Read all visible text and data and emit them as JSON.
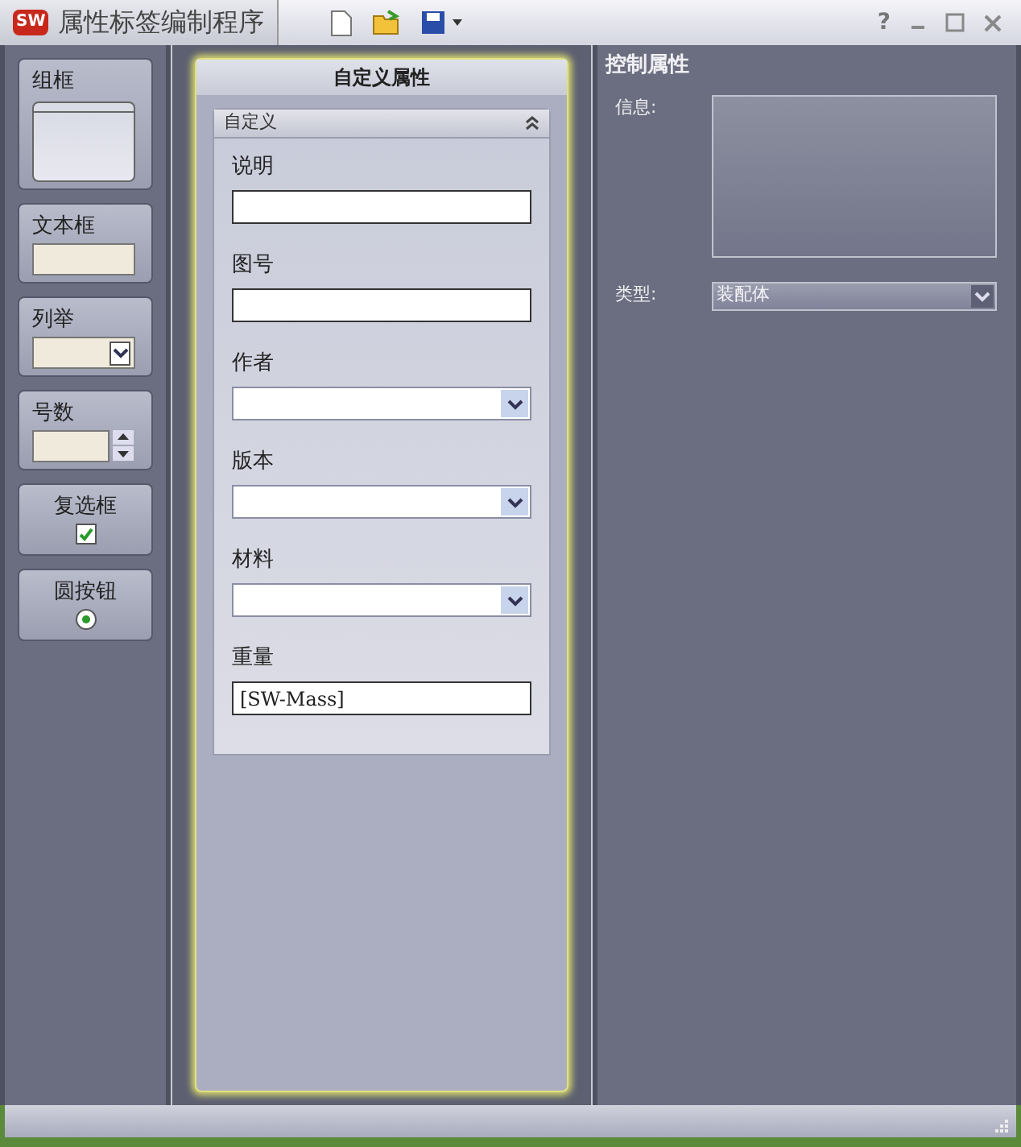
{
  "window": {
    "logo": "SW",
    "title": "属性标签编制程序",
    "help": "?"
  },
  "toolbox": [
    {
      "kind": "groupbox",
      "label": "组框"
    },
    {
      "kind": "textbox",
      "label": "文本框"
    },
    {
      "kind": "combo",
      "label": "列举"
    },
    {
      "kind": "spin",
      "label": "号数"
    },
    {
      "kind": "checkbox",
      "label": "复选框",
      "checked": true
    },
    {
      "kind": "radio",
      "label": "圆按钮",
      "selected": true
    }
  ],
  "form": {
    "title": "自定义属性",
    "group": {
      "title": "自定义",
      "expanded": true,
      "fields": [
        {
          "kind": "text",
          "label": "说明"
        },
        {
          "kind": "text",
          "label": "图号"
        },
        {
          "kind": "dropdown",
          "label": "作者"
        },
        {
          "kind": "dropdown",
          "label": "版本"
        },
        {
          "kind": "dropdown",
          "label": "材料"
        },
        {
          "kind": "text",
          "label": "重量",
          "value": "[SW-Mass]"
        }
      ]
    }
  },
  "properties": {
    "title": "控制属性",
    "info_label": "信息:",
    "type_label": "类型:",
    "type_value": "装配体"
  }
}
